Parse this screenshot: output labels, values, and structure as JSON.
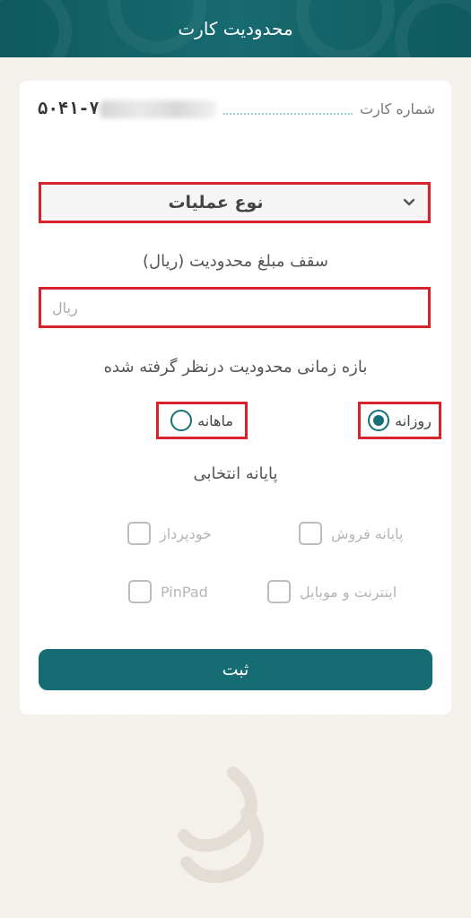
{
  "header": {
    "title": "محدودیت کارت"
  },
  "card_number": {
    "label": "شماره کارت",
    "value": "۵۰۴۱-۷"
  },
  "operation_select": {
    "selected": "نوع عملیات"
  },
  "amount": {
    "title": "سقف مبلغ محدودیت (ریال)",
    "placeholder": "ریال"
  },
  "period": {
    "title": "بازه زمانی محدودیت درنظر گرفته شده",
    "options": [
      {
        "label": "روزانه",
        "selected": true
      },
      {
        "label": "ماهانه",
        "selected": false
      }
    ]
  },
  "terminals": {
    "title": "پایانه انتخابی",
    "items": [
      {
        "label": "پایانه فروش"
      },
      {
        "label": "خودپرداز"
      },
      {
        "label": "اینترنت و موبایل"
      },
      {
        "label": "PinPad"
      }
    ]
  },
  "submit": {
    "label": "ثبت"
  },
  "colors": {
    "brand": "#156c72",
    "highlight": "#d6232c"
  }
}
